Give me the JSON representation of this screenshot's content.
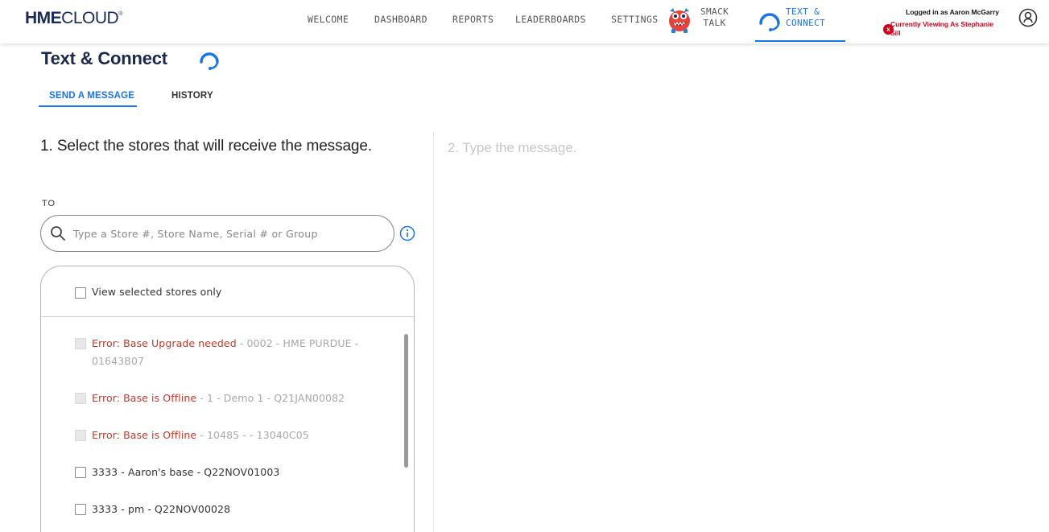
{
  "brand": {
    "hme": "HME",
    "cloud": "CLOUD",
    "reg": "®"
  },
  "nav": {
    "welcome": "WELCOME",
    "dashboard": "DASHBOARD",
    "reports": "REPORTS",
    "leaderboards": "LEADERBOARDS",
    "settings": "SETTINGS",
    "smack_line1": "SMACK",
    "smack_line2": "TALK",
    "tc_line1": "TEXT &",
    "tc_line2": "CONNECT"
  },
  "user": {
    "logged_in": "Logged in as Aaron McGarry",
    "viewing_as": "Currently Viewing As Stephanie Sill",
    "badge": "x"
  },
  "page": {
    "title": "Text & Connect",
    "tabs": [
      {
        "label": "SEND A MESSAGE"
      },
      {
        "label": "HISTORY"
      }
    ],
    "step1": "1. Select the stores that will receive the message.",
    "step2": "2. Type the message."
  },
  "search": {
    "to_label": "TO",
    "placeholder": "Type a Store #, Store Name, Serial # or Group"
  },
  "stores": {
    "view_selected": "View selected stores only",
    "items": [
      {
        "error": "Error: Base Upgrade needed",
        "detail": " - 0002 - HME PURDUE - 01643B07"
      },
      {
        "error": "Error: Base is Offline",
        "detail": " - 1 - Demo 1 - Q21JAN00082"
      },
      {
        "error": "Error: Base is Offline",
        "detail": " - 10485 - - 13040C05"
      },
      {
        "error": "",
        "detail": "3333 - Aaron's base - Q22NOV01003"
      },
      {
        "error": "",
        "detail": "3333 - pm - Q22NOV00028"
      }
    ]
  },
  "colors": {
    "accent": "#1a73e8",
    "error": "#c0392b",
    "badge": "#d0021b",
    "brand": "#1a2a5a"
  },
  "icons": [
    "smack-talk-monster-icon",
    "headset-icon",
    "user-account-icon",
    "search-icon",
    "info-icon"
  ]
}
